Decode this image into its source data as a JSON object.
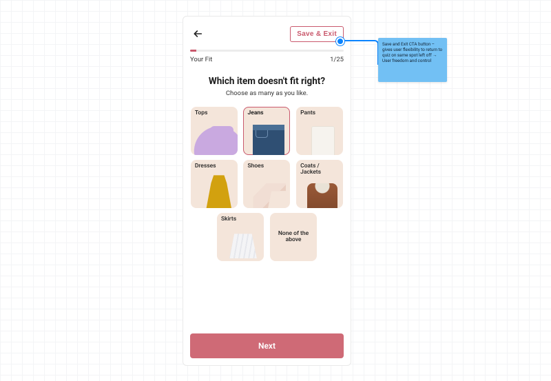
{
  "header": {
    "save_exit_label": "Save & Exit"
  },
  "progress": {
    "section_label": "Your Fit",
    "step_display": "1/25",
    "current": 1,
    "total": 25,
    "percent": 4
  },
  "question": {
    "title": "Which item doesn't fit right?",
    "subtitle": "Choose as many as you like."
  },
  "options": [
    {
      "id": "tops",
      "label": "Tops",
      "selected": false
    },
    {
      "id": "jeans",
      "label": "Jeans",
      "selected": true
    },
    {
      "id": "pants",
      "label": "Pants",
      "selected": false
    },
    {
      "id": "dresses",
      "label": "Dresses",
      "selected": false
    },
    {
      "id": "shoes",
      "label": "Shoes",
      "selected": false
    },
    {
      "id": "coats",
      "label": "Coats / Jackets",
      "selected": false
    },
    {
      "id": "skirts",
      "label": "Skirts",
      "selected": false
    },
    {
      "id": "none",
      "label": "None of the above",
      "selected": false
    }
  ],
  "cta": {
    "next_label": "Next"
  },
  "annotation": {
    "text": "Save and Exit CTA button – gives user flexibility to return to quiz on same spot left off → User freedom and control",
    "author": ""
  },
  "colors": {
    "accent": "#c9586c",
    "card_bg": "#f4e5da",
    "note_bg": "#72c0f4",
    "pin": "#0a84ff"
  }
}
